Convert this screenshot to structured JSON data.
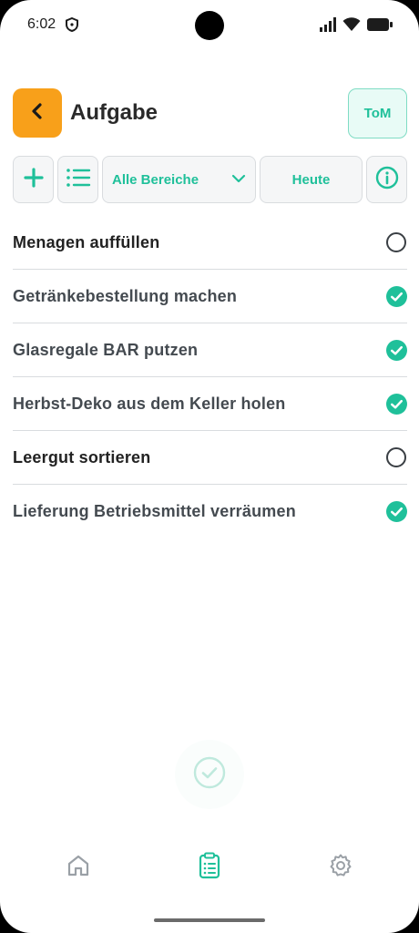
{
  "status_bar": {
    "time": "6:02"
  },
  "header": {
    "title": "Aufgabe",
    "user_badge": "ToM"
  },
  "toolbar": {
    "area_select_value": "Alle Bereiche",
    "date_button_label": "Heute"
  },
  "tasks": [
    {
      "label": "Menagen auffüllen",
      "done": false
    },
    {
      "label": "Getränkebestellung machen",
      "done": true
    },
    {
      "label": "Glasregale BAR putzen",
      "done": true
    },
    {
      "label": "Herbst-Deko aus dem Keller holen",
      "done": true
    },
    {
      "label": "Leergut sortieren",
      "done": false
    },
    {
      "label": "Lieferung Betriebsmittel verräumen",
      "done": true
    }
  ],
  "colors": {
    "accent": "#1fc09a",
    "back_button": "#f8a01a"
  },
  "icons": {
    "back": "chevron-left-icon",
    "add": "plus-icon",
    "list": "list-icon",
    "dropdown": "chevron-down-icon",
    "info": "info-icon",
    "nav_home": "home-icon",
    "nav_tasks": "clipboard-icon",
    "nav_settings": "gear-icon"
  }
}
